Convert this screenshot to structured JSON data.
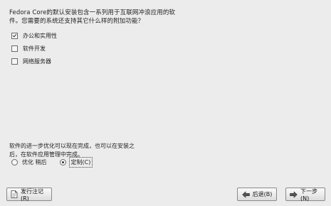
{
  "intro": {
    "line1": "Fedora Core的默认安装包含一系列用于互联网冲浪应用的软",
    "line2": "件。您需要的系统还支持其它什么样的附加功能？"
  },
  "groups": [
    {
      "label": "办公和实用性",
      "checked": true
    },
    {
      "label": "软件开发",
      "checked": false
    },
    {
      "label": "网络服务器",
      "checked": false
    }
  ],
  "note": {
    "line1": "软件的进一步优化可以现在完成，也可以在安装之",
    "line2": "后，在软件应用管理中完成。"
  },
  "customize": {
    "options": [
      {
        "label": "优化 稍后",
        "selected": false
      },
      {
        "label": "定制(C)",
        "selected": true
      }
    ]
  },
  "buttons": {
    "release_notes": "发行注记(R)",
    "back": "后退(B)",
    "next": "下一步(N)"
  }
}
